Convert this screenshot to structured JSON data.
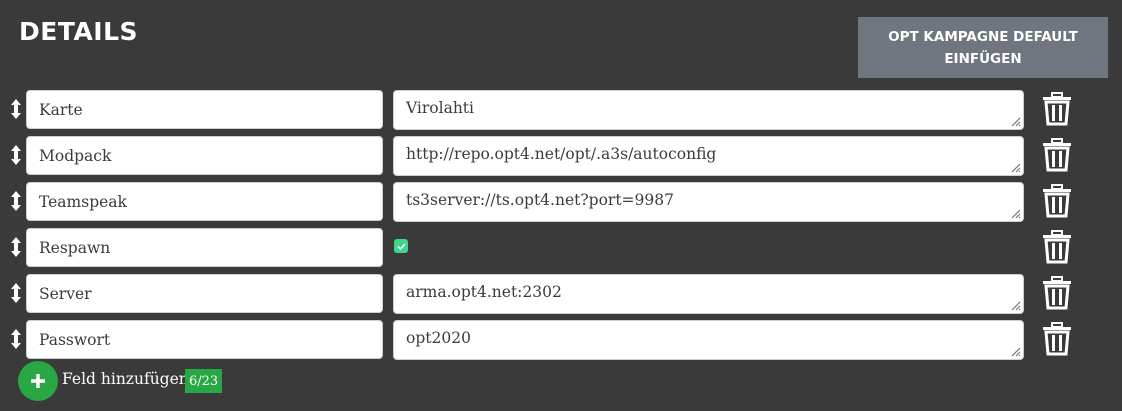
{
  "header": {
    "title": "DETAILS",
    "default_button_label": "OPT KAMPAGNE DEFAULT EINFÜGEN"
  },
  "fields": [
    {
      "key": "Karte",
      "value": "Virolahti",
      "type": "text"
    },
    {
      "key": "Modpack",
      "value": "http://repo.opt4.net/opt/.a3s/autoconfig",
      "type": "text"
    },
    {
      "key": "Teamspeak",
      "value": "ts3server://ts.opt4.net?port=9987",
      "type": "text"
    },
    {
      "key": "Respawn",
      "value": true,
      "type": "checkbox"
    },
    {
      "key": "Server",
      "value": "arma.opt4.net:2302",
      "type": "text"
    },
    {
      "key": "Passwort",
      "value": "opt2020",
      "type": "text"
    }
  ],
  "footer": {
    "add_label": "Feld hinzufügen",
    "count": "6/23"
  },
  "icons": {
    "drag": "drag-handle-icon",
    "delete": "trash-icon",
    "add": "plus-icon",
    "check": "check-icon"
  },
  "colors": {
    "background": "#3a3a3a",
    "default_button": "#707680",
    "add_button": "#29a745",
    "badge": "#28a745",
    "checkbox": "#3dd68c"
  }
}
